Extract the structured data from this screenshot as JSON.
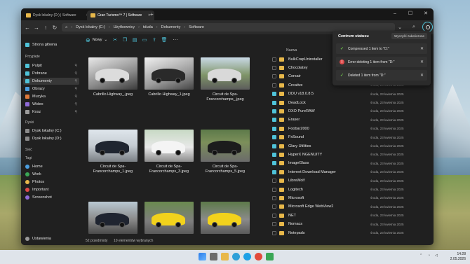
{
  "tabs": [
    {
      "label": "Dysk lokalny (D:) | Software"
    },
    {
      "label": "Gran Turismo™ 7 | Software"
    }
  ],
  "breadcrumb": [
    "Dysk lokalny (C:)",
    "Użytkownicy",
    "tduda",
    "Dokumenty",
    "Software"
  ],
  "sidebar": {
    "home": "Strona główna",
    "sections": {
      "favorites": "Przypięte",
      "drives": "Dyski",
      "network": "Sieć",
      "tags": "Tagi"
    },
    "favorites": [
      "Pulpit",
      "Pobrane",
      "Dokumenty",
      "Obrazy",
      "Muzyka",
      "Wideo",
      "Kosz"
    ],
    "drives": [
      "Dysk lokalny (C:)",
      "Dysk lokalny (D:)"
    ],
    "tags": [
      "Home",
      "Work",
      "Photos",
      "Important",
      "Screenshot"
    ],
    "settings": "Ustawienia"
  },
  "toolbar": {
    "new_label": "Nowy"
  },
  "thumbnails": [
    {
      "label": "Cabrillo Highway_.jpeg"
    },
    {
      "label": "Cabrillo Highway_1.jpeg"
    },
    {
      "label": "Circuit de Spa-Francorchamps_.jpeg"
    },
    {
      "label": "Circuit de Spa-Francorchamps_1.jpeg"
    },
    {
      "label": "Circuit de Spa-Francorchamps_3.jpeg"
    },
    {
      "label": "Circuit de Spa-Francorchamps_5.jpeg"
    }
  ],
  "list": {
    "header": "Nazwa",
    "rows": [
      {
        "name": "BulkCrapUninstaller",
        "date": "",
        "checked": false
      },
      {
        "name": "Chocolatey",
        "date": "",
        "checked": false
      },
      {
        "name": "Corsair",
        "date": "",
        "checked": false
      },
      {
        "name": "Creative",
        "date": "środa, 23 kwietnia 2025",
        "checked": false
      },
      {
        "name": "DDU v18.0.8.5",
        "date": "środa, 23 kwietnia 2025",
        "checked": true
      },
      {
        "name": "DeadLock",
        "date": "środa, 23 kwietnia 2025",
        "checked": true
      },
      {
        "name": "DXO PureRAW",
        "date": "środa, 23 kwietnia 2025",
        "checked": true
      },
      {
        "name": "Eraser",
        "date": "środa, 23 kwietnia 2025",
        "checked": true
      },
      {
        "name": "Foobar2000",
        "date": "środa, 23 kwietnia 2025",
        "checked": true
      },
      {
        "name": "FxSound",
        "date": "środa, 23 kwietnia 2025",
        "checked": true
      },
      {
        "name": "Glary Utilities",
        "date": "środa, 23 kwietnia 2025",
        "checked": true
      },
      {
        "name": "HyperX NGENUITY",
        "date": "środa, 23 kwietnia 2025",
        "checked": true
      },
      {
        "name": "ImageGlass",
        "date": "środa, 23 kwietnia 2025",
        "checked": true
      },
      {
        "name": "Internet Download Manager",
        "date": "środa, 23 kwietnia 2025",
        "checked": true
      },
      {
        "name": "LibreWolf",
        "date": "środa, 23 kwietnia 2025",
        "checked": false
      },
      {
        "name": "Logitech",
        "date": "środa, 23 kwietnia 2025",
        "checked": false
      },
      {
        "name": "Microsoft",
        "date": "środa, 23 kwietnia 2025",
        "checked": false
      },
      {
        "name": "Microsoft Edge WebView2",
        "date": "środa, 23 kwietnia 2025",
        "checked": false
      },
      {
        "name": "NET",
        "date": "środa, 23 kwietnia 2025",
        "checked": false
      },
      {
        "name": "Nomacs",
        "date": "środa, 23 kwietnia 2025",
        "checked": false
      },
      {
        "name": "Notepads",
        "date": "środa, 23 kwietnia 2025",
        "checked": false
      }
    ]
  },
  "statusbar": {
    "items": "52 przedmioty",
    "selected": "10 elementów wybranych"
  },
  "notifications": {
    "title": "Centrum statusu",
    "clear_label": "Wyczyść zakończone",
    "items": [
      {
        "text": "Compressed 1 item to \"D:\"",
        "status": "success"
      },
      {
        "text": "Error deleting 1 item from \"D:\"",
        "status": "error"
      },
      {
        "text": "Deleted 1 item from \"D:\"",
        "status": "success"
      }
    ]
  },
  "taskbar": {
    "time": "14:28",
    "date": "2.05.2026"
  },
  "colors": {
    "accent": "#4fc3d9",
    "folder": "#e8b84a",
    "success": "#6cc24a",
    "error": "#e04a4a"
  }
}
